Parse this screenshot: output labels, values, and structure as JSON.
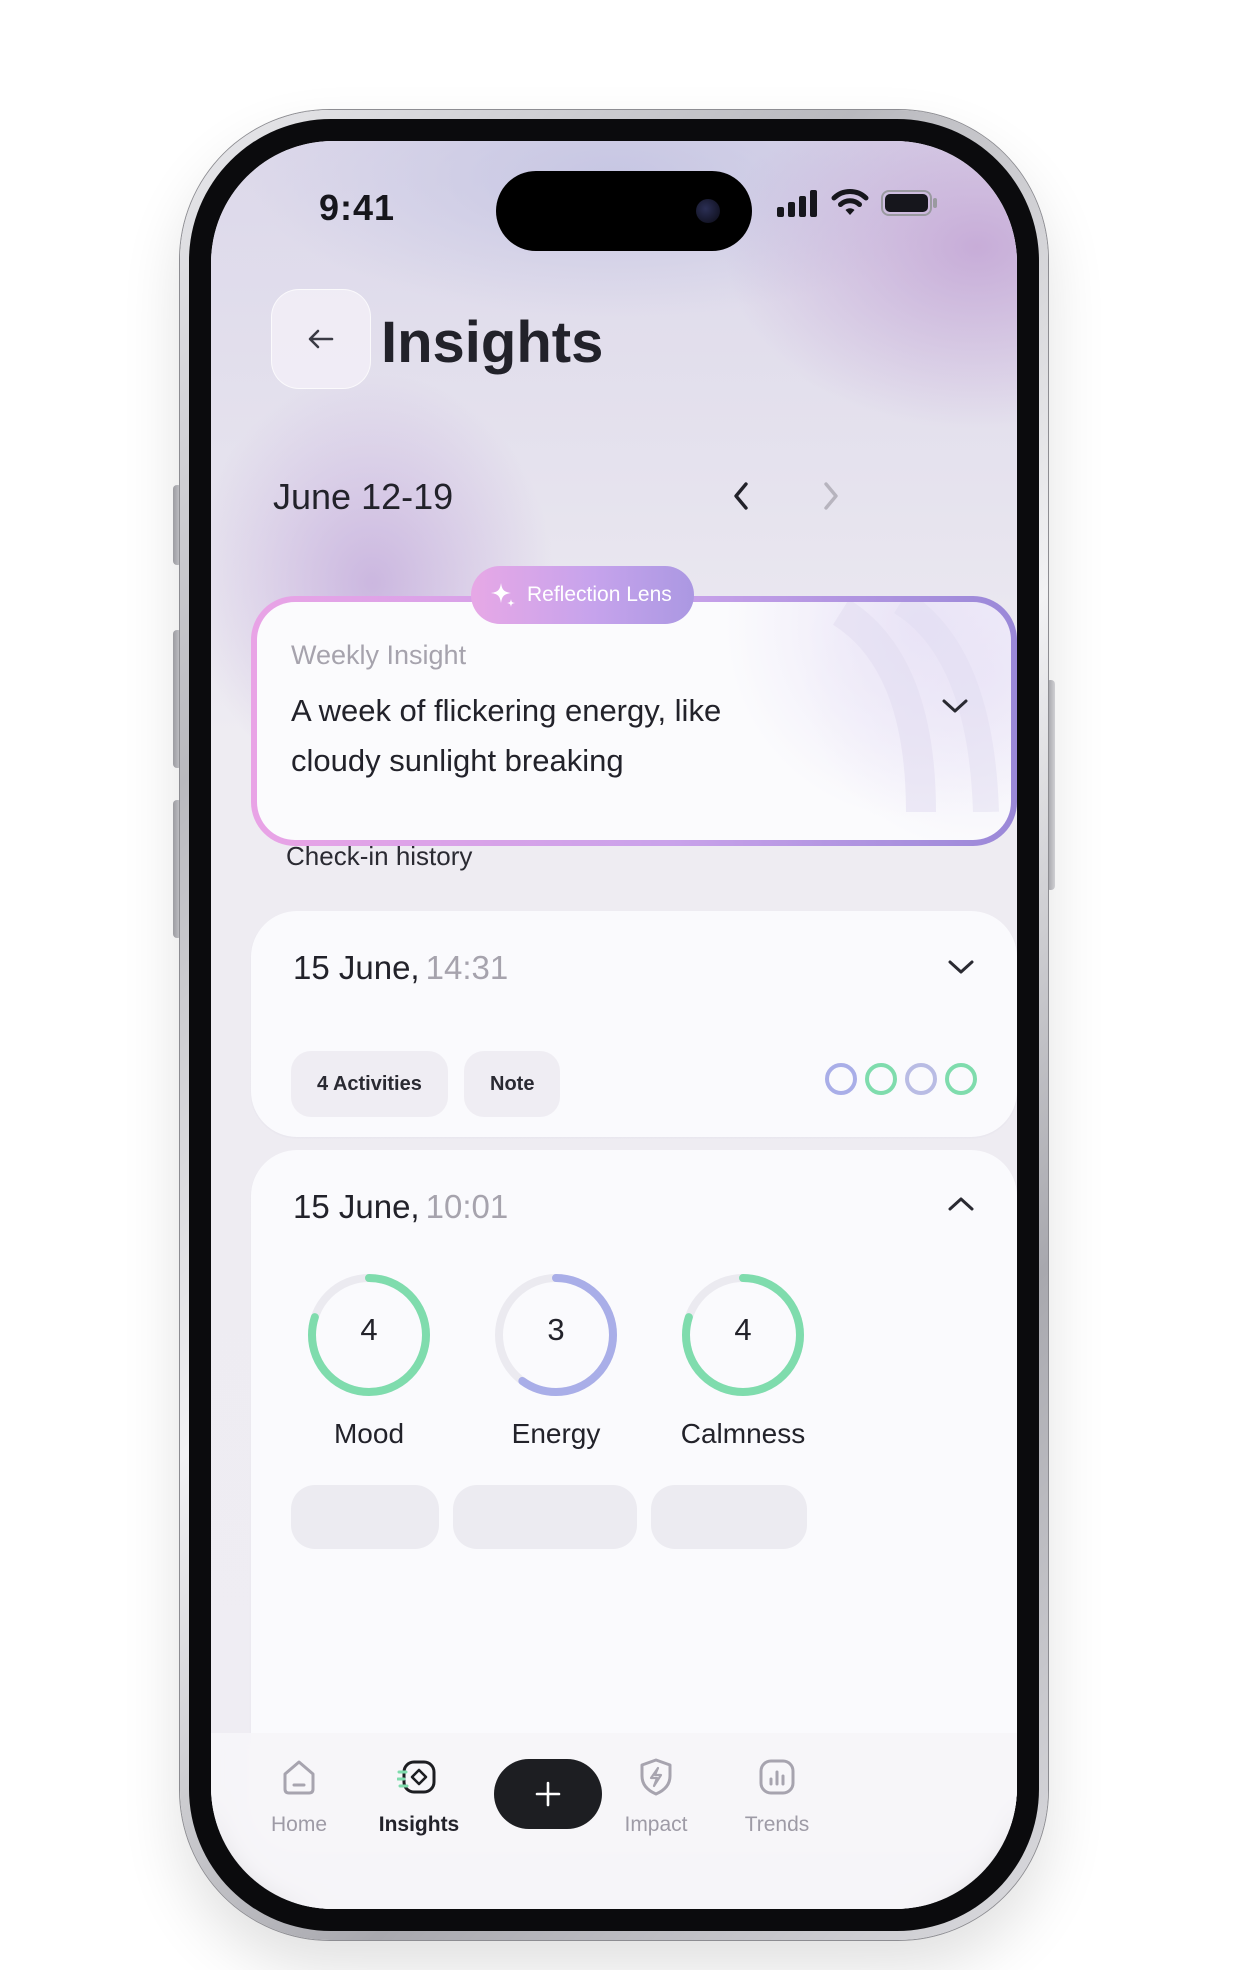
{
  "status_bar": {
    "time": "9:41"
  },
  "header": {
    "title": "Insights",
    "back_icon": "arrow-left-icon"
  },
  "week": {
    "label": "June 12-19",
    "prev_icon": "chevron-left-icon",
    "next_icon": "chevron-right-icon"
  },
  "insight": {
    "badge": "Reflection Lens",
    "badge_icon": "sparkle-icon",
    "kicker": "Weekly Insight",
    "text": "A week of flickering energy, like cloudy sunlight breaking",
    "gradient_colors": [
      "#e9a3e6",
      "#c9a2ea",
      "#9a88d8"
    ]
  },
  "history": {
    "title": "Check-in history",
    "entries": [
      {
        "date": "15 June,",
        "time": "14:31",
        "expanded": false,
        "chips": [
          "4 Activities",
          "Note"
        ],
        "dot_colors": [
          "#a9aee8",
          "#7fdcad",
          "#b9bce4",
          "#7fdcad"
        ]
      },
      {
        "date": "15 June,",
        "time": "10:01",
        "expanded": true,
        "metrics": [
          {
            "label": "Mood",
            "value": "4",
            "max": 5,
            "color": "#7fdcad"
          },
          {
            "label": "Energy",
            "value": "3",
            "max": 5,
            "color": "#a9aee8"
          },
          {
            "label": "Calmness",
            "value": "4",
            "max": 5,
            "color": "#7fdcad"
          }
        ]
      }
    ]
  },
  "tabbar": {
    "tabs": [
      {
        "label": "Home",
        "icon": "home-icon",
        "active": false
      },
      {
        "label": "Insights",
        "icon": "insights-icon",
        "active": true
      },
      {
        "label": "Impact",
        "icon": "bolt-shield-icon",
        "active": false
      },
      {
        "label": "Trends",
        "icon": "bar-chart-icon",
        "active": false
      }
    ],
    "add_icon": "plus-icon"
  },
  "colors": {
    "accent_green": "#7fdcad",
    "accent_lavender": "#a9aee8",
    "dark": "#1d1e22"
  }
}
